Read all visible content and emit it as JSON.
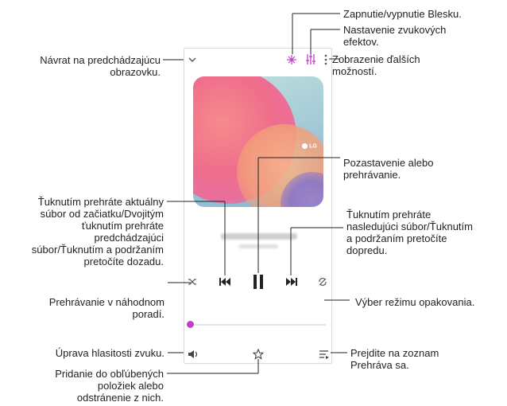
{
  "callouts": {
    "flash": "Zapnutie/vypnutie Blesku.",
    "effects": [
      "Nastavenie zvukových",
      "efektov."
    ],
    "more": [
      "Zobrazenie ďalších",
      "možností."
    ],
    "back": [
      "Návrat na predchádzajúcu",
      "obrazovku."
    ],
    "pause": [
      "Pozastavenie alebo",
      "prehrávanie."
    ],
    "prev": [
      "Ťuknutím prehráte aktuálny",
      "súbor od začiatku/Dvojitým",
      "ťuknutím prehráte",
      "predchádzajúci",
      "súbor/Ťuknutím a podržaním",
      "pretočíte dozadu."
    ],
    "next": [
      "Ťuknutím prehráte",
      "nasledujúci súbor/Ťuknutím",
      "a podržaním pretočíte",
      "dopredu."
    ],
    "shuffle": [
      "Prehrávanie v náhodnom",
      "poradí."
    ],
    "repeat": "Výber režimu opakovania.",
    "volume": "Úprava hlasitosti zvuku.",
    "playlist": [
      "Prejdite na zoznam",
      "Prehráva sa."
    ],
    "favorite": [
      "Pridanie do obľúbených",
      "položiek alebo",
      "odstránenie z nich."
    ]
  },
  "screen": {
    "album_logo": "LG",
    "accent_color": "#c13ec8"
  },
  "icons": [
    "chevron-down-icon",
    "flash-icon",
    "equalizer-icon",
    "more-vert-icon",
    "shuffle-icon",
    "previous-icon",
    "pause-icon",
    "next-icon",
    "repeat-icon",
    "volume-icon",
    "star-icon",
    "playlist-icon"
  ]
}
